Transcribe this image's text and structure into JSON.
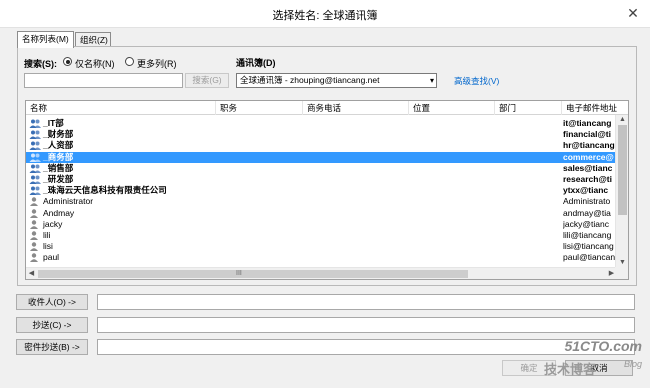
{
  "window": {
    "title": "选择姓名: 全球通讯簿",
    "close_glyph": "✕"
  },
  "tabs": [
    {
      "label": "名称列表(M)"
    },
    {
      "label": "组织(Z)"
    }
  ],
  "search": {
    "label": "搜索(S):",
    "radio_name_only": "仅名称(N)",
    "radio_more_columns": "更多列(R)",
    "input_value": "",
    "button": "搜索(G)"
  },
  "address_book": {
    "label": "通讯簿(D)",
    "selected": "全球通讯簿 - zhouping@tiancang.net",
    "advanced_link": "高级查找(V)"
  },
  "columns": [
    "名称",
    "职务",
    "商务电话",
    "位置",
    "部门",
    "电子邮件地址"
  ],
  "rows": [
    {
      "name": "_IT部",
      "email": "it@tiancang",
      "type": "group",
      "selected": false
    },
    {
      "name": "_财务部",
      "email": "financial@ti",
      "type": "group",
      "selected": false
    },
    {
      "name": "_人资部",
      "email": "hr@tiancang",
      "type": "group",
      "selected": false
    },
    {
      "name": "_商务部",
      "email": "commerce@",
      "type": "group",
      "selected": true
    },
    {
      "name": "_销售部",
      "email": "sales@tianc",
      "type": "group",
      "selected": false
    },
    {
      "name": "_研发部",
      "email": "research@ti",
      "type": "group",
      "selected": false
    },
    {
      "name": "_珠海云天信息科技有限责任公司",
      "email": "ytxx@tianc",
      "type": "group",
      "selected": false
    },
    {
      "name": "Administrator",
      "email": "Administrato",
      "type": "user",
      "selected": false
    },
    {
      "name": "Andmay",
      "email": "andmay@tia",
      "type": "user",
      "selected": false
    },
    {
      "name": "jacky",
      "email": "jacky@tianc",
      "type": "user",
      "selected": false
    },
    {
      "name": "lili",
      "email": "lili@tiancang",
      "type": "user",
      "selected": false
    },
    {
      "name": "lisi",
      "email": "lisi@tiancang",
      "type": "user",
      "selected": false
    },
    {
      "name": "paul",
      "email": "paul@tiancan",
      "type": "user",
      "selected": false
    }
  ],
  "scrollbar": {
    "grip": "III"
  },
  "recipients": [
    {
      "label": "收件人(O) ->",
      "value": ""
    },
    {
      "label": "抄送(C) ->",
      "value": ""
    },
    {
      "label": "密件抄送(B) ->",
      "value": ""
    }
  ],
  "footer": {
    "ok": "确定",
    "cancel": "取消"
  },
  "watermark": {
    "line1": "51CTO.com",
    "line2": "技术博客",
    "line3": "Blog"
  },
  "colors": {
    "selection": "#3399ff",
    "link": "#0066cc",
    "group_icon": "#3a6fb5",
    "user_icon": "#8a8a8a"
  }
}
